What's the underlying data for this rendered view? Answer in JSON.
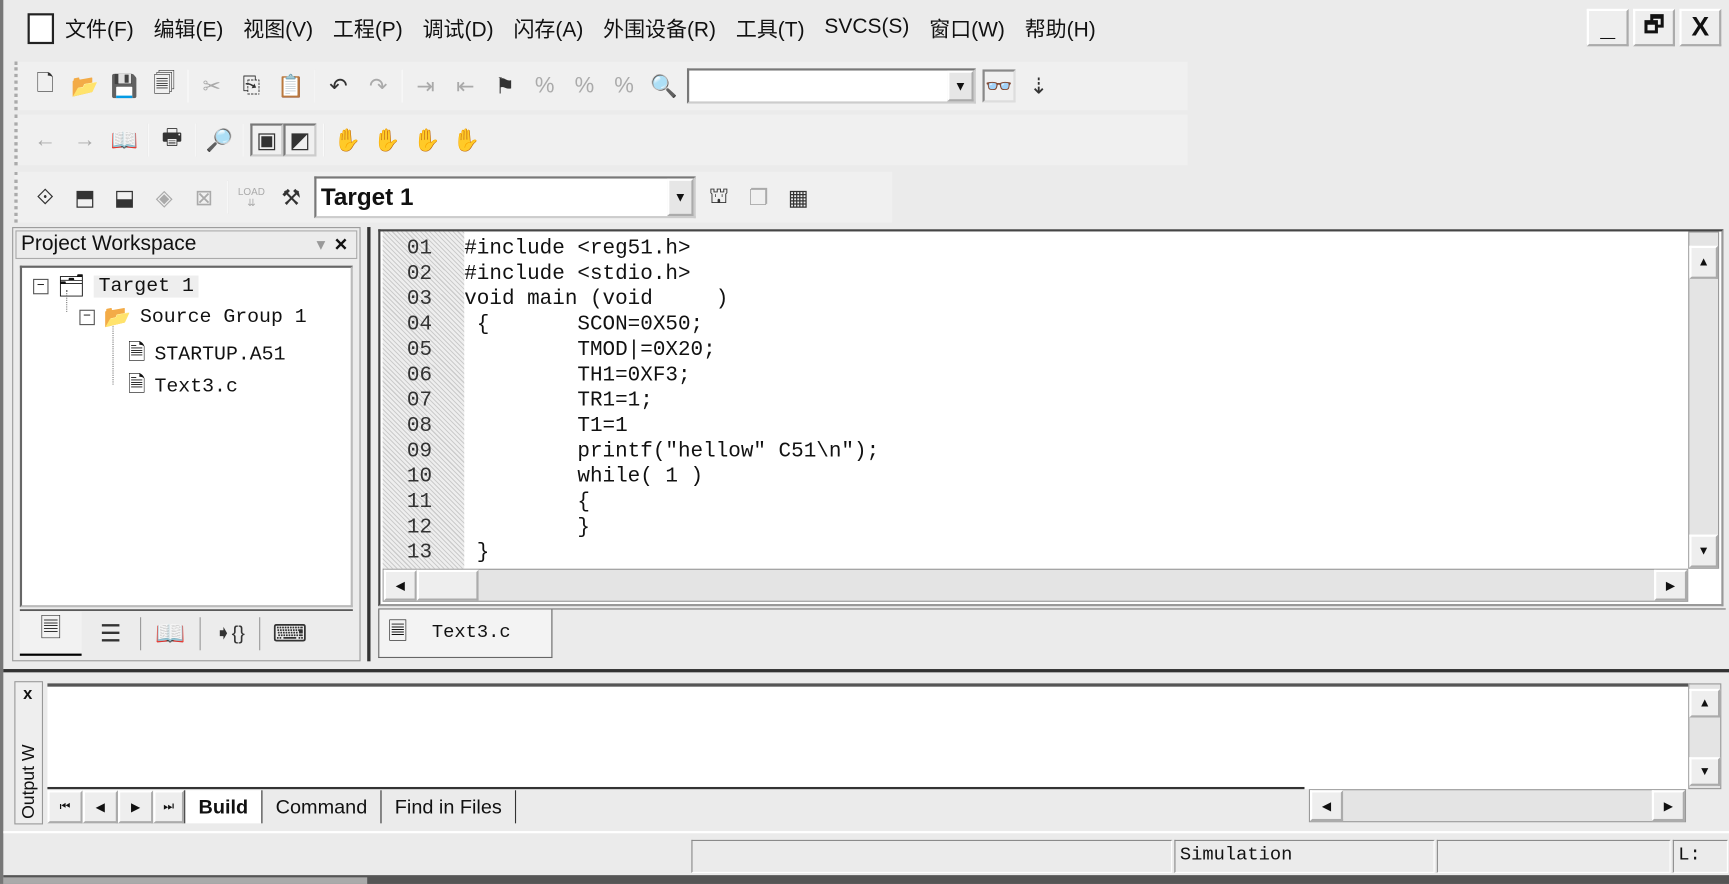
{
  "menu": {
    "items": [
      "文件(F)",
      "编辑(E)",
      "视图(V)",
      "工程(P)",
      "调试(D)",
      "闪存(A)",
      "外围设备(R)",
      "工具(T)",
      "SVCS(S)",
      "窗口(W)",
      "帮助(H)"
    ]
  },
  "window_controls": {
    "minimize": "_",
    "restore": "🗗",
    "close": "X"
  },
  "toolbar": {
    "find_value": "",
    "target_value": "Target 1",
    "load_label": "LOAD"
  },
  "workspace": {
    "title": "Project Workspace",
    "pin": "▾",
    "close": "×",
    "tree": [
      {
        "label": "Target 1",
        "level": 0
      },
      {
        "label": "Source Group 1",
        "level": 1
      },
      {
        "label": "STARTUP.A51",
        "level": 2
      },
      {
        "label": "Text3.c",
        "level": 2
      }
    ]
  },
  "editor": {
    "lines": [
      {
        "n": "01",
        "code": "#include <reg51.h>"
      },
      {
        "n": "02",
        "code": "#include <stdio.h>"
      },
      {
        "n": "03",
        "code": "void main (void     )"
      },
      {
        "n": "04",
        "code": " {       SCON=0X50;"
      },
      {
        "n": "05",
        "code": "         TMOD|=0X20;"
      },
      {
        "n": "06",
        "code": "         TH1=0XF3;"
      },
      {
        "n": "07",
        "code": "         TR1=1;"
      },
      {
        "n": "08",
        "code": "         T1=1"
      },
      {
        "n": "09",
        "code": "         printf(\"hellow\" C51\\n\");"
      },
      {
        "n": "10",
        "code": "         while( 1 )"
      },
      {
        "n": "11",
        "code": "         {"
      },
      {
        "n": "12",
        "code": "         }"
      },
      {
        "n": "13",
        "code": " }"
      }
    ],
    "tab": "Text3.c"
  },
  "output": {
    "title": "Output W",
    "close": "x",
    "tabs": [
      "Build",
      "Command",
      "Find in Files"
    ],
    "active_tab": "Build"
  },
  "status": {
    "mode": "Simulation",
    "position": "L:"
  }
}
